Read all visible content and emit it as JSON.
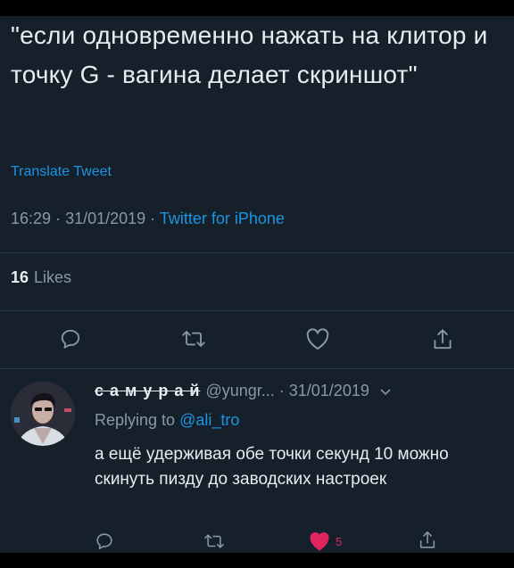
{
  "tweet": {
    "text": "\"если одновременно нажать на клитор и точку G - вагина делает скриншот\"",
    "translate_label": "Translate Tweet",
    "time": "16:29",
    "date": "31/01/2019",
    "source": "Twitter for iPhone",
    "likes_count": "16",
    "likes_label": "Likes"
  },
  "actions": [
    {
      "icon": "reply-icon"
    },
    {
      "icon": "retweet-icon"
    },
    {
      "icon": "heart-icon"
    },
    {
      "icon": "share-icon"
    }
  ],
  "reply": {
    "display_name": "с а м у р а й",
    "handle": "@yungr...",
    "date": "· 31/01/2019",
    "replying_to_label": "Replying to",
    "replying_to_handle": "@ali_tro",
    "text": "а ещё удерживая обе точки секунд 10 можно скинуть пизду до заводских настроек",
    "like_count": "5"
  },
  "colors": {
    "background": "#15202b",
    "accent": "#1b95e0",
    "like": "#e0245e",
    "secondary_text": "#8899a6"
  }
}
